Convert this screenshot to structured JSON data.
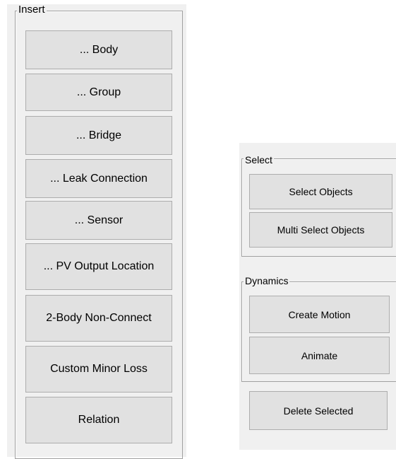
{
  "insert_panel": {
    "title": "Insert",
    "buttons": [
      "... Body",
      "... Group",
      "... Bridge",
      "... Leak Connection",
      "... Sensor",
      "... PV Output Location",
      "2-Body Non-Connect",
      "Custom Minor Loss",
      "Relation"
    ]
  },
  "select_panel": {
    "title": "Select",
    "buttons": [
      "Select Objects",
      "Multi Select Objects"
    ]
  },
  "dynamics_panel": {
    "title": "Dynamics",
    "buttons": [
      "Create Motion",
      "Animate"
    ]
  },
  "delete_button": "Delete Selected"
}
